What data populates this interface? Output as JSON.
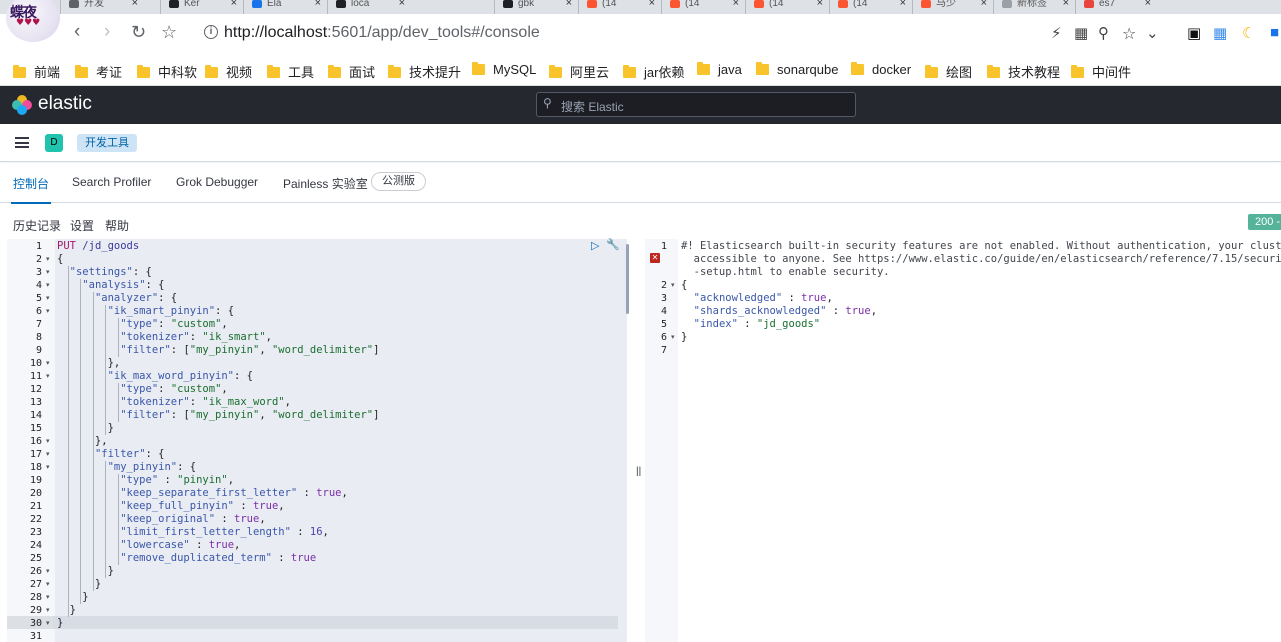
{
  "browser": {
    "tabs": [
      {
        "label": "开发",
        "color": "#5f6368"
      },
      {
        "label": "Ker",
        "color": "#202124"
      },
      {
        "label": "Ela",
        "color": "#1a73e8"
      },
      {
        "label": "loca",
        "color": "#202124"
      },
      {
        "label": "gbk",
        "color": "#202124"
      },
      {
        "label": "(14",
        "color": "#fc5531"
      },
      {
        "label": "(14",
        "color": "#fc5531"
      },
      {
        "label": "(14",
        "color": "#fc5531"
      },
      {
        "label": "(14",
        "color": "#fc5531"
      },
      {
        "label": "马少",
        "color": "#fc5531"
      },
      {
        "label": "新标签",
        "color": "#9aa0a6"
      },
      {
        "label": "es7",
        "color": "#e8453c"
      }
    ],
    "url_host": "http://localhost",
    "url_rest": ":5601/app/dev_tools#/console",
    "bookmarks": [
      "前端",
      "考证",
      "中科软",
      "视频",
      "工具",
      "面试",
      "技术提升",
      "MySQL",
      "阿里云",
      "jar依赖",
      "java",
      "sonarqube",
      "docker",
      "绘图",
      "技术教程",
      "中间件"
    ]
  },
  "kibana": {
    "brand": "elastic",
    "search_placeholder": "搜索 Elastic",
    "space_initial": "D",
    "breadcrumb": "开发工具",
    "tabs": [
      "控制台",
      "Search Profiler",
      "Grok Debugger",
      "Painless 实验室"
    ],
    "beta_badge": "公测版",
    "console_menu": [
      "历史记录",
      "设置",
      "帮助"
    ],
    "status": "200 -"
  },
  "request": {
    "lines": [
      "PUT /jd_goods",
      "{",
      "  \"settings\": {",
      "    \"analysis\": {",
      "      \"analyzer\": {",
      "        \"ik_smart_pinyin\": {",
      "          \"type\": \"custom\",",
      "          \"tokenizer\": \"ik_smart\",",
      "          \"filter\": [\"my_pinyin\", \"word_delimiter\"]",
      "        },",
      "        \"ik_max_word_pinyin\": {",
      "          \"type\": \"custom\",",
      "          \"tokenizer\": \"ik_max_word\",",
      "          \"filter\": [\"my_pinyin\", \"word_delimiter\"]",
      "        }",
      "      },",
      "      \"filter\": {",
      "        \"my_pinyin\": {",
      "          \"type\" : \"pinyin\",",
      "          \"keep_separate_first_letter\" : true,",
      "          \"keep_full_pinyin\" : true,",
      "          \"keep_original\" : true,",
      "          \"limit_first_letter_length\" : 16,",
      "          \"lowercase\" : true,",
      "          \"remove_duplicated_term\" : true",
      "        }",
      "      }",
      "    }",
      "  }",
      "}",
      ""
    ]
  },
  "response": {
    "lines": [
      {
        "num": "1",
        "text": "#! Elasticsearch built-in security features are not enabled. Without authentication, your cluster could be"
      },
      {
        "num": "",
        "text": "  accessible to anyone. See https://www.elastic.co/guide/en/elasticsearch/reference/7.15/security-minimal"
      },
      {
        "num": "",
        "text": "  -setup.html to enable security."
      },
      {
        "num": "2",
        "text": "{"
      },
      {
        "num": "3",
        "text": "  \"acknowledged\" : true,"
      },
      {
        "num": "4",
        "text": "  \"shards_acknowledged\" : true,"
      },
      {
        "num": "5",
        "text": "  \"index\" : \"jd_goods\""
      },
      {
        "num": "6",
        "text": "}"
      },
      {
        "num": "7",
        "text": ""
      }
    ]
  }
}
